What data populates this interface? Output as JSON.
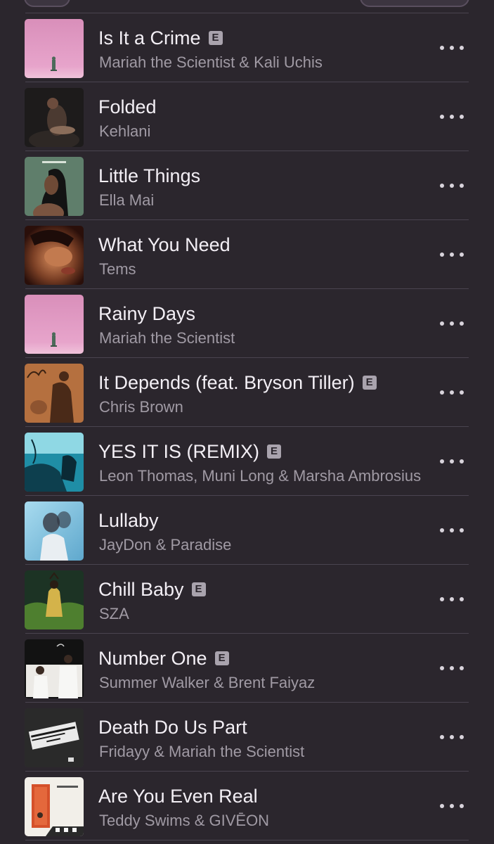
{
  "tracks": [
    {
      "title": "Is It a Crime",
      "artist": "Mariah the Scientist & Kali Uchis",
      "explicit": true,
      "explicit_label": "E",
      "artwork": "pink-sky-figure-artwork"
    },
    {
      "title": "Folded",
      "artist": "Kehlani",
      "explicit": false,
      "artwork": "dark-portrait-artwork"
    },
    {
      "title": "Little Things",
      "artist": "Ella Mai",
      "explicit": false,
      "artwork": "green-portrait-artwork"
    },
    {
      "title": "What You Need",
      "artist": "Tems",
      "explicit": false,
      "artwork": "warm-portrait-artwork"
    },
    {
      "title": "Rainy Days",
      "artist": "Mariah the Scientist",
      "explicit": false,
      "artwork": "pink-sky-figure-artwork"
    },
    {
      "title": "It Depends (feat. Bryson Tiller)",
      "artist": "Chris Brown",
      "explicit": true,
      "explicit_label": "E",
      "artwork": "sepia-sketch-artwork"
    },
    {
      "title": "YES IT IS (REMIX)",
      "artist": "Leon Thomas, Muni Long & Marsha Ambrosius",
      "explicit": true,
      "explicit_label": "E",
      "artwork": "teal-scene-artwork"
    },
    {
      "title": "Lullaby",
      "artist": "JayDon & Paradise",
      "explicit": false,
      "artwork": "blue-blur-portrait-artwork"
    },
    {
      "title": "Chill Baby",
      "artist": "SZA",
      "explicit": true,
      "explicit_label": "E",
      "artwork": "forest-figure-artwork"
    },
    {
      "title": "Number One",
      "artist": "Summer Walker & Brent Faiyaz",
      "explicit": true,
      "explicit_label": "E",
      "artwork": "white-group-photo-artwork"
    },
    {
      "title": "Death Do Us Part",
      "artist": "Fridayy & Mariah the Scientist",
      "explicit": false,
      "artwork": "billboard-artwork"
    },
    {
      "title": "Are You Even Real",
      "artist": "Teddy Swims & GIVĒON",
      "explicit": false,
      "artwork": "orange-door-artwork"
    }
  ],
  "colors": {
    "background": "#2b262d",
    "title_text": "#f3eff5",
    "artist_text": "#a09aa4",
    "divider": "#4a4450"
  }
}
